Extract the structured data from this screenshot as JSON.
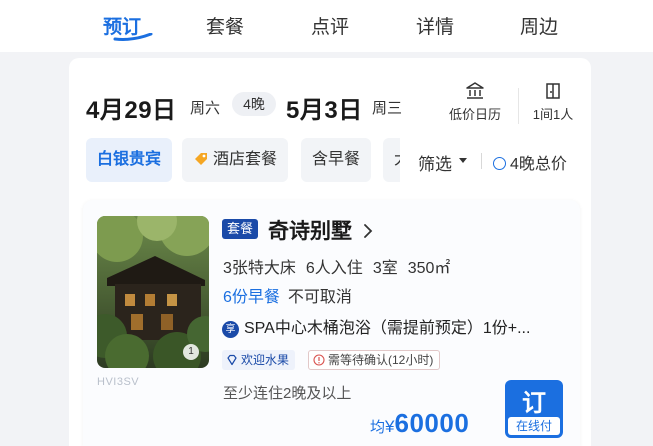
{
  "tabs": [
    {
      "label": "预订",
      "active": true
    },
    {
      "label": "套餐",
      "active": false
    },
    {
      "label": "点评",
      "active": false
    },
    {
      "label": "详情",
      "active": false
    },
    {
      "label": "周边",
      "active": false
    }
  ],
  "stay": {
    "checkin_date": "4月29日",
    "checkin_weekday": "周六",
    "nights": "4晚",
    "checkout_date": "5月3日",
    "checkout_weekday": "周三"
  },
  "tools": {
    "calendar_label": "低价日历",
    "calendar_icon": "bank-icon",
    "guests_label": "1间1人",
    "guests_icon": "door-icon"
  },
  "chips": {
    "silver": "白银贵宾",
    "package": "酒店套餐",
    "breakfast": "含早餐",
    "partial": "大"
  },
  "filter": {
    "label": "筛选",
    "total_price_toggle": "4晚总价"
  },
  "room": {
    "package_badge": "套餐",
    "name": "奇诗别墅",
    "beds": "3张特大床",
    "occupancy": "6人入住",
    "rooms": "3室",
    "area": "350㎡",
    "breakfast": "6份早餐",
    "cancellation": "不可取消",
    "perk_icon_text": "享",
    "perk": "SPA中心木桶泡浴（需提前预定）1份+...",
    "photo_count": "1",
    "photo_code": "HVI3SV",
    "tags": {
      "fruit": "欢迎水果",
      "confirm": "需等待确认(12小时)"
    },
    "min_stay": "至少连住2晚及以上",
    "price_prefix": "均",
    "currency": "¥",
    "price": "60000",
    "book_label": "订",
    "book_sub": "在线付"
  },
  "colors": {
    "accent": "#1b6fe0",
    "badge_navy": "#1a4aa8",
    "chip_bg": "#f2f4f7"
  }
}
